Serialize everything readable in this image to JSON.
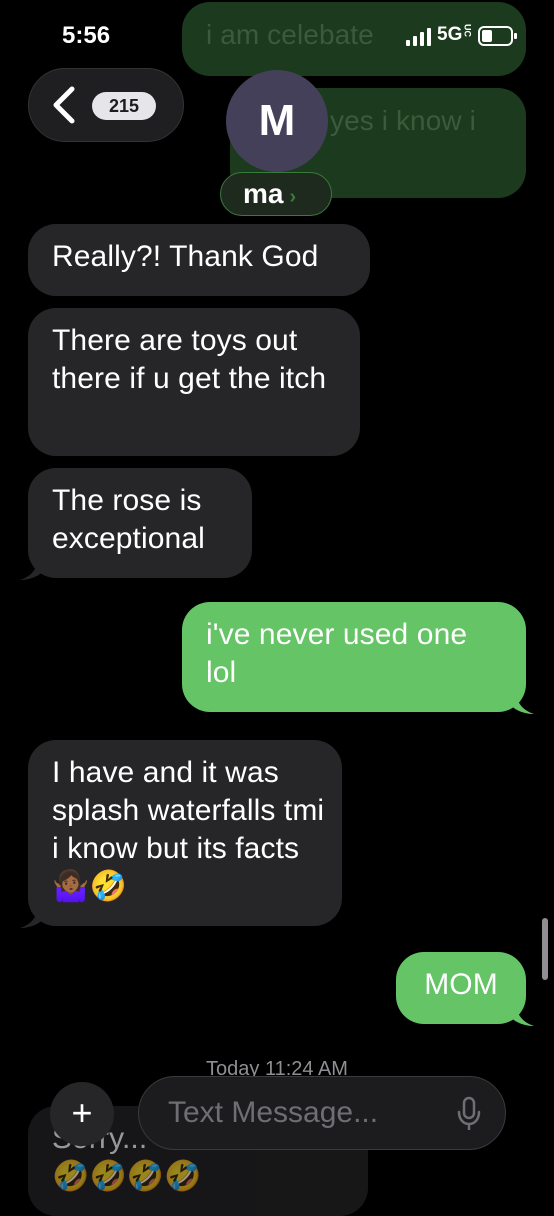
{
  "status_bar": {
    "time": "5:56",
    "network": "5G",
    "network_sub": "UC"
  },
  "header": {
    "back_count": "215",
    "avatar_letter": "M",
    "contact_name": "ma"
  },
  "ghost_messages": [
    "i am celebate",
    "yes i know i"
  ],
  "messages": [
    {
      "direction": "incoming",
      "text": "Really?! Thank God"
    },
    {
      "direction": "incoming",
      "text": "There are toys out there if u get the itch"
    },
    {
      "direction": "incoming",
      "text": "The rose is exceptional"
    },
    {
      "direction": "outgoing",
      "text": "i've never used one lol"
    },
    {
      "direction": "incoming",
      "text": "I have and it was splash waterfalls tmi i know but its facts🤷🏾‍♀️🤣"
    },
    {
      "direction": "outgoing",
      "text": "MOM"
    }
  ],
  "timestamp": "Today 11:24 AM",
  "hidden_message": {
    "text": "Sorry...",
    "emoji": "🤣🤣🤣🤣"
  },
  "composer": {
    "placeholder": "Text Message...",
    "plus": "+"
  },
  "colors": {
    "outgoing": "#65c466",
    "incoming": "#262628",
    "background": "#000000"
  }
}
